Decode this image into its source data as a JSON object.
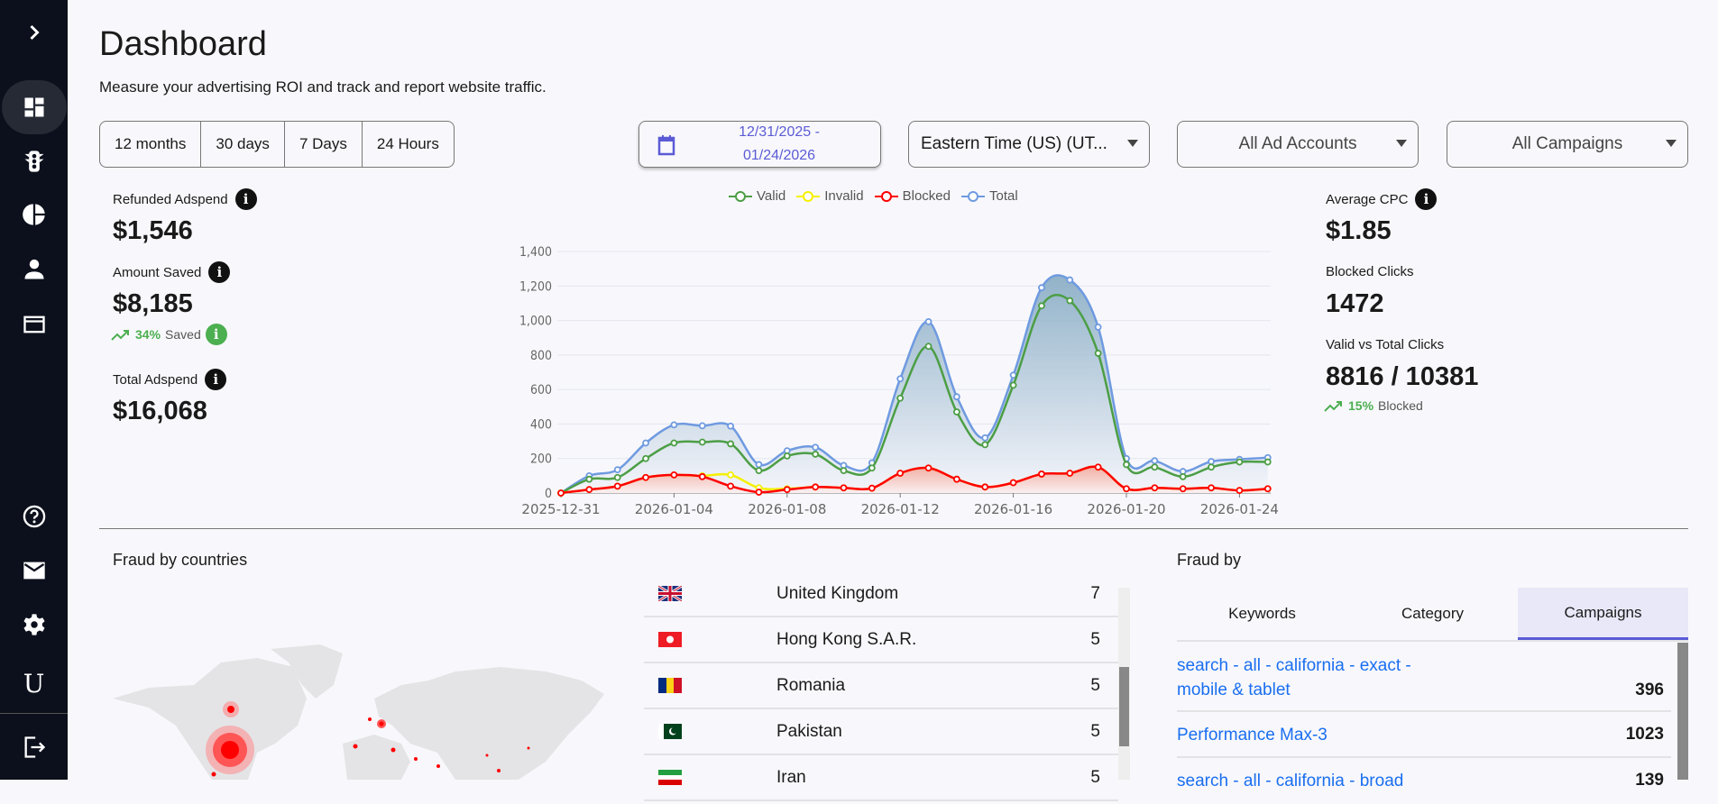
{
  "sidebar": {
    "items": [
      "expand",
      "dashboard",
      "traffic",
      "reports",
      "account",
      "billing",
      "help",
      "mail",
      "settings",
      "user",
      "logout"
    ],
    "user_initial": "U"
  },
  "header": {
    "title": "Dashboard",
    "subtitle": "Measure your advertising ROI and track and report website traffic."
  },
  "ranges": [
    "12 months",
    "30 days",
    "7 Days",
    "24 Hours"
  ],
  "filters": {
    "date_start": "12/31/2025 -",
    "date_end": "01/24/2026",
    "timezone": "Eastern Time (US) (UT...",
    "ad_accounts": "All Ad Accounts",
    "campaigns": "All Campaigns"
  },
  "stats_left": {
    "refunded_label": "Refunded Adspend",
    "refunded_value": "$1,546",
    "saved_label": "Amount Saved",
    "saved_value": "$8,185",
    "saved_pct": "34%",
    "saved_text": "Saved",
    "total_label": "Total Adspend",
    "total_value": "$16,068"
  },
  "stats_right": {
    "cpc_label": "Average CPC",
    "cpc_value": "$1.85",
    "blocked_label": "Blocked Clicks",
    "blocked_value": "1472",
    "vt_label": "Valid vs Total Clicks",
    "vt_value": "8816 / 10381",
    "blocked_pct": "15%",
    "blocked_text": "Blocked"
  },
  "chart_data": {
    "type": "line",
    "x": [
      "2025-12-31",
      "2026-01-01",
      "2026-01-02",
      "2026-01-03",
      "2026-01-04",
      "2026-01-05",
      "2026-01-06",
      "2026-01-07",
      "2026-01-08",
      "2026-01-09",
      "2026-01-10",
      "2026-01-11",
      "2026-01-12",
      "2026-01-13",
      "2026-01-14",
      "2026-01-15",
      "2026-01-16",
      "2026-01-17",
      "2026-01-18",
      "2026-01-19",
      "2026-01-20",
      "2026-01-21",
      "2026-01-22",
      "2026-01-23",
      "2026-01-24",
      "2026-01-25"
    ],
    "xticks": [
      "2025-12-31",
      "2026-01-04",
      "2026-01-08",
      "2026-01-12",
      "2026-01-16",
      "2026-01-20",
      "2026-01-24"
    ],
    "yticks": [
      "0",
      "200",
      "400",
      "600",
      "800",
      "1,000",
      "1,200",
      "1,400"
    ],
    "ylim": [
      0,
      1400
    ],
    "legend_position": "top",
    "series": [
      {
        "name": "Valid",
        "color": "#4c9e45",
        "values": [
          0,
          80,
          90,
          200,
          290,
          295,
          285,
          130,
          215,
          225,
          130,
          145,
          550,
          850,
          470,
          280,
          625,
          1085,
          1115,
          810,
          165,
          150,
          95,
          150,
          180,
          180
        ]
      },
      {
        "name": "Invalid",
        "color": "#f5f000",
        "values": [
          0,
          20,
          40,
          90,
          105,
          100,
          105,
          30,
          25,
          35,
          30,
          28,
          115,
          145,
          80,
          35,
          60,
          110,
          115,
          150,
          25,
          30,
          25,
          30,
          15,
          25
        ]
      },
      {
        "name": "Blocked",
        "color": "#ff0000",
        "values": [
          0,
          20,
          40,
          90,
          105,
          95,
          40,
          5,
          20,
          35,
          30,
          28,
          115,
          145,
          80,
          35,
          60,
          110,
          115,
          150,
          25,
          30,
          25,
          30,
          15,
          25
        ]
      },
      {
        "name": "Total",
        "color": "#6f9ae0",
        "values": [
          0,
          100,
          135,
          290,
          395,
          390,
          388,
          165,
          245,
          265,
          160,
          175,
          662,
          993,
          558,
          320,
          683,
          1190,
          1235,
          962,
          200,
          187,
          125,
          183,
          195,
          205
        ]
      }
    ]
  },
  "countries": {
    "title": "Fraud by countries",
    "rows": [
      {
        "name": "United Kingdom",
        "count": "7"
      },
      {
        "name": "Hong Kong S.A.R.",
        "count": "5"
      },
      {
        "name": "Romania",
        "count": "5"
      },
      {
        "name": "Pakistan",
        "count": "5"
      },
      {
        "name": "Iran",
        "count": "5"
      }
    ]
  },
  "fraud_by": {
    "title": "Fraud by",
    "tabs": [
      "Keywords",
      "Category",
      "Campaigns"
    ],
    "active_tab": "Campaigns",
    "rows": [
      {
        "name": "search - all - california - exact - mobile & tablet",
        "count": "396"
      },
      {
        "name": "Performance Max-3",
        "count": "1023"
      },
      {
        "name": "search - all - california - broad",
        "count": "139"
      }
    ]
  }
}
